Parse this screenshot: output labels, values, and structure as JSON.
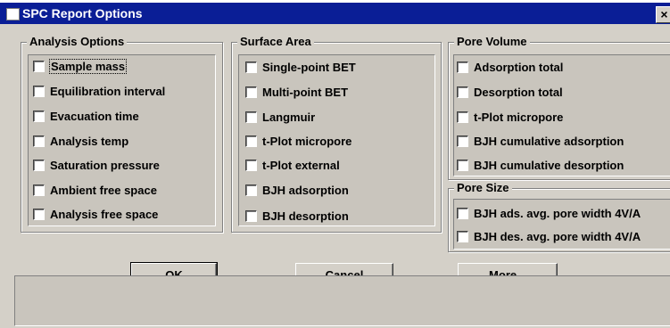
{
  "window": {
    "title": "SPC Report Options",
    "close_label": "×"
  },
  "analysis_options": {
    "title": "Analysis Options",
    "items": [
      {
        "label": "Sample mass",
        "checked": false
      },
      {
        "label": "Equilibration interval",
        "checked": false
      },
      {
        "label": "Evacuation time",
        "checked": false
      },
      {
        "label": "Analysis temp",
        "checked": false
      },
      {
        "label": "Saturation pressure",
        "checked": false
      },
      {
        "label": "Ambient free space",
        "checked": false
      },
      {
        "label": "Analysis free space",
        "checked": false
      }
    ]
  },
  "surface_area": {
    "title": "Surface Area",
    "items": [
      {
        "label": "Single-point BET",
        "checked": false
      },
      {
        "label": "Multi-point BET",
        "checked": false
      },
      {
        "label": "Langmuir",
        "checked": false
      },
      {
        "label": "t-Plot micropore",
        "checked": false
      },
      {
        "label": "t-Plot external",
        "checked": false
      },
      {
        "label": "BJH adsorption",
        "checked": false
      },
      {
        "label": "BJH desorption",
        "checked": false
      }
    ]
  },
  "pore_volume": {
    "title": "Pore Volume",
    "items": [
      {
        "label": "Adsorption total",
        "checked": false
      },
      {
        "label": "Desorption total",
        "checked": false
      },
      {
        "label": "t-Plot micropore",
        "checked": false
      },
      {
        "label": "BJH cumulative adsorption",
        "checked": false
      },
      {
        "label": "BJH cumulative desorption",
        "checked": false
      }
    ]
  },
  "pore_size": {
    "title": "Pore Size",
    "items": [
      {
        "label": "BJH ads. avg. pore width 4V/A",
        "checked": false
      },
      {
        "label": "BJH des. avg. pore width 4V/A",
        "checked": false
      }
    ]
  },
  "buttons": {
    "ok": "OK",
    "cancel": "Cancel",
    "more": "More..."
  },
  "status_text": ""
}
